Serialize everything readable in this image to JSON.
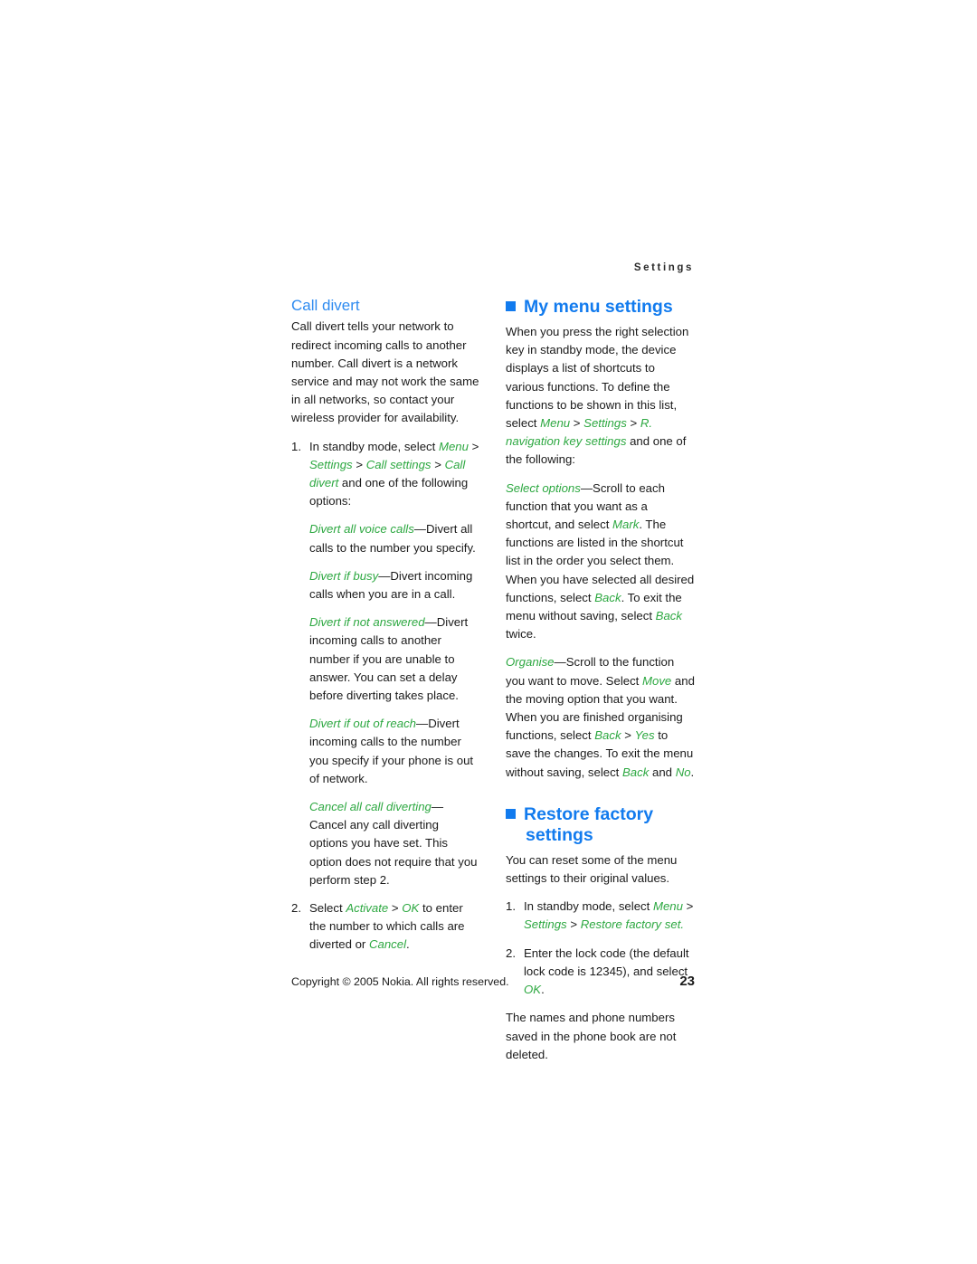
{
  "header": {
    "running_title": "Settings"
  },
  "left_column": {
    "sub_heading": "Call divert",
    "intro": "Call divert tells your network to redirect incoming calls to another number. Call divert is a network service and may not work the same in all networks, so contact your wireless provider for availability.",
    "step1_num": "1.",
    "step1_pre": "In standby mode, select ",
    "step1_menu_1": "Menu",
    "step1_sep_1": " > ",
    "step1_menu_2": "Settings",
    "step1_sep_2": " > ",
    "step1_menu_3": "Call settings",
    "step1_sep_3": " > ",
    "step1_menu_4": "Call divert",
    "step1_post": " and one of the following options:",
    "def1_term": "Divert all voice calls",
    "def1_text": "—Divert all calls to the number you specify.",
    "def2_term": "Divert if busy",
    "def2_text": "—Divert incoming calls when you are in a call.",
    "def3_term": "Divert if not answered",
    "def3_text": "—Divert incoming calls to another number if you are unable to answer. You can set a delay before diverting takes place.",
    "def4_term": "Divert if out of reach",
    "def4_text": "—Divert incoming calls to the number you specify if your phone is out of network.",
    "def5_term": "Cancel all call diverting",
    "def5_text": "—Cancel any call diverting options you have set. This option does not require that you perform step 2.",
    "step2_num": "2.",
    "step2_pre": "Select ",
    "step2_menu_1": "Activate",
    "step2_sep_1": " > ",
    "step2_menu_2": "OK",
    "step2_mid": " to enter the number to which calls are diverted or ",
    "step2_menu_3": "Cancel",
    "step2_post": "."
  },
  "right_column": {
    "heading_1": "My menu settings",
    "intro_pre": "When you press the right selection key in standby mode, the device displays a list of shortcuts to various functions. To define the functions to be shown in this list, select ",
    "intro_menu_1": "Menu",
    "intro_sep_1": " > ",
    "intro_menu_2": "Settings",
    "intro_sep_2": " > ",
    "intro_menu_3": "R. navigation key settings",
    "intro_post": " and one of the following:",
    "select_term": "Select options",
    "select_text_1": "—Scroll to each function that you want as a shortcut, and select ",
    "select_menu_1": "Mark",
    "select_text_2": ". The functions are listed in the shortcut list in the order you select them. When you have selected all desired functions, select ",
    "select_menu_2": "Back",
    "select_text_3": ". To exit the menu without saving, select ",
    "select_menu_3": "Back",
    "select_text_4": " twice.",
    "organise_term": "Organise",
    "organise_text_1": "—Scroll to the function you want to move. Select ",
    "organise_menu_1": "Move",
    "organise_text_2": " and the moving option that you want. When you are finished organising functions, select ",
    "organise_menu_2": "Back",
    "organise_sep_1": " > ",
    "organise_menu_3": "Yes",
    "organise_text_3": " to save the changes. To exit the menu without saving, select ",
    "organise_menu_4": "Back",
    "organise_text_4": " and ",
    "organise_menu_5": "No",
    "organise_text_5": ".",
    "heading_2_line1": "Restore factory",
    "heading_2_line2": "settings",
    "restore_intro": "You can reset some of the menu settings to their original values.",
    "rstep1_num": "1.",
    "rstep1_pre": "In standby mode, select ",
    "rstep1_menu_1": "Menu",
    "rstep1_sep_1": " > ",
    "rstep1_menu_2": "Settings",
    "rstep1_sep_2": " > ",
    "rstep1_menu_3": "Restore factory set.",
    "rstep2_num": "2.",
    "rstep2_pre": "Enter the lock code (the default lock code is 12345), and select ",
    "rstep2_menu_1": "OK",
    "rstep2_post": ".",
    "closing": "The names and phone numbers saved in the phone book are not deleted."
  },
  "footer": {
    "copyright": "Copyright © 2005 Nokia. All rights reserved.",
    "page_number": "23"
  },
  "colors": {
    "heading_blue": "#127BEE",
    "sub_heading_blue": "#2E8BF0",
    "menu_green": "#2DA841",
    "body_text": "#1a1a1a",
    "background": "#ffffff"
  }
}
